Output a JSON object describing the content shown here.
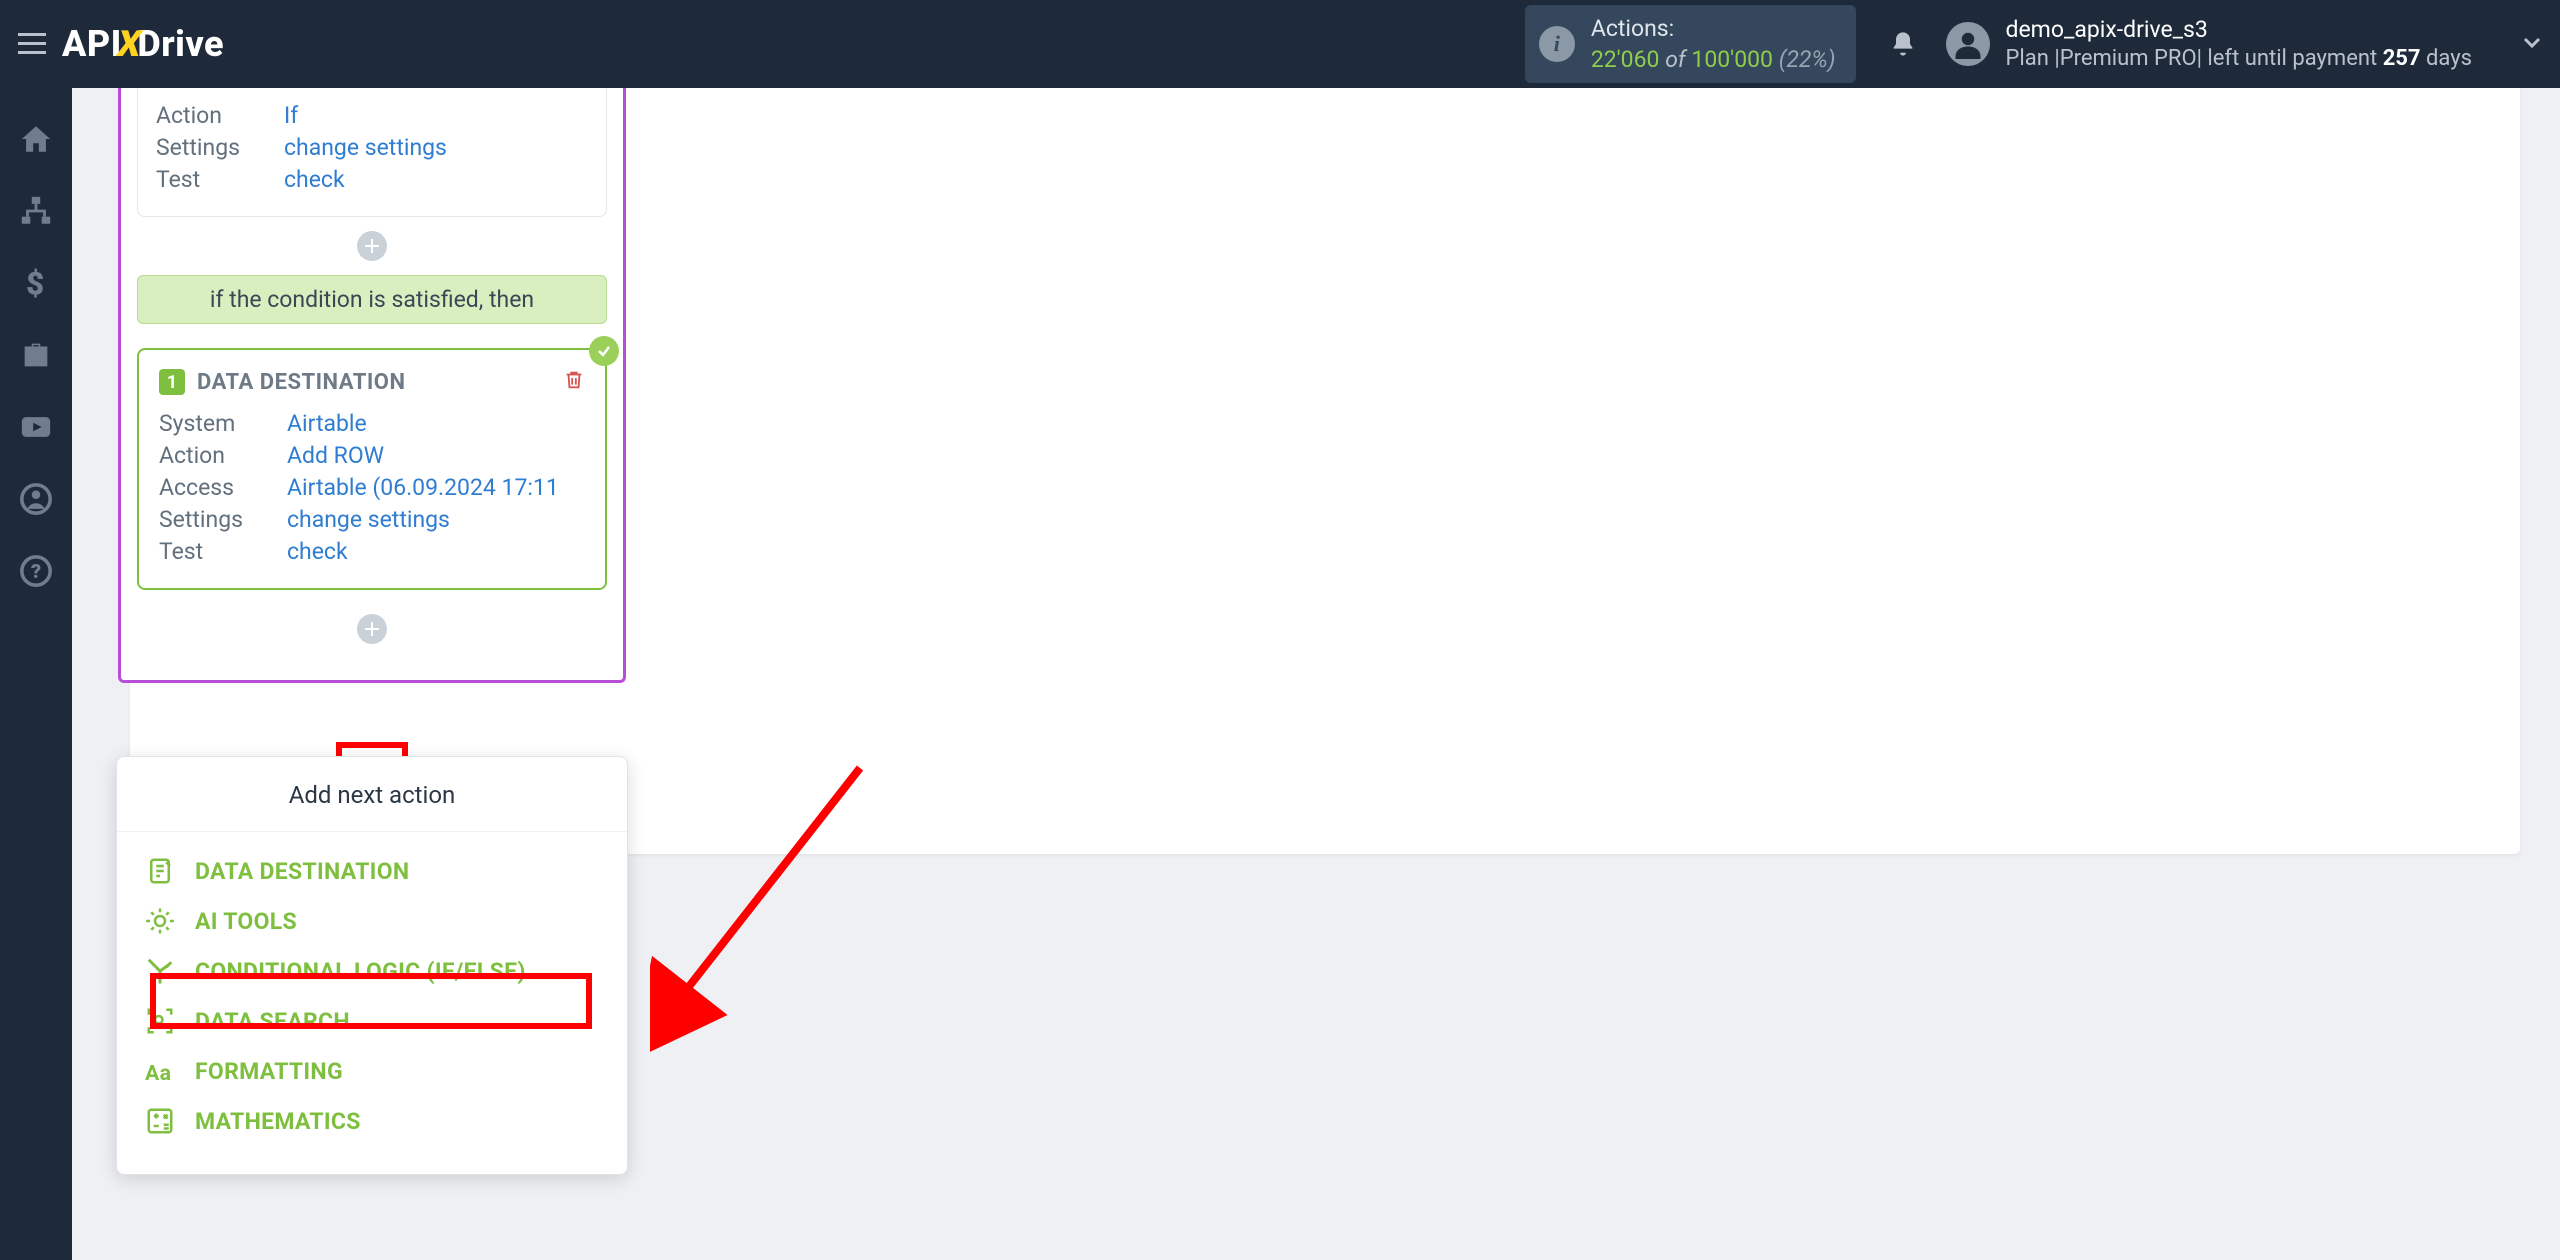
{
  "logo": {
    "part1": "API",
    "part2": "X",
    "part3": "Drive"
  },
  "actions": {
    "label": "Actions:",
    "used": "22'060",
    "of": "of",
    "limit": "100'000",
    "pct": "(22%)"
  },
  "user": {
    "name": "demo_apix-drive_s3",
    "plan_prefix": "Plan |Premium PRO| left until payment ",
    "days": "257",
    "days_suffix": " days"
  },
  "block1": {
    "action_k": "Action",
    "action_v": "If",
    "settings_k": "Settings",
    "settings_v": "change settings",
    "test_k": "Test",
    "test_v": "check"
  },
  "cond_satisfied": "if the condition is satisfied, then",
  "dest": {
    "num": "1",
    "title": "DATA DESTINATION",
    "system_k": "System",
    "system_v": "Airtable",
    "action_k": "Action",
    "action_v": "Add ROW",
    "access_k": "Access",
    "access_v": "Airtable (06.09.2024 17:11",
    "settings_k": "Settings",
    "settings_v": "change settings",
    "test_k": "Test",
    "test_v": "check"
  },
  "popover": {
    "title": "Add next action",
    "items": [
      "DATA DESTINATION",
      "AI TOOLS",
      "CONDITIONAL LOGIC (IF/ELSE)",
      "DATA SEARCH",
      "FORMATTING",
      "MATHEMATICS"
    ]
  }
}
